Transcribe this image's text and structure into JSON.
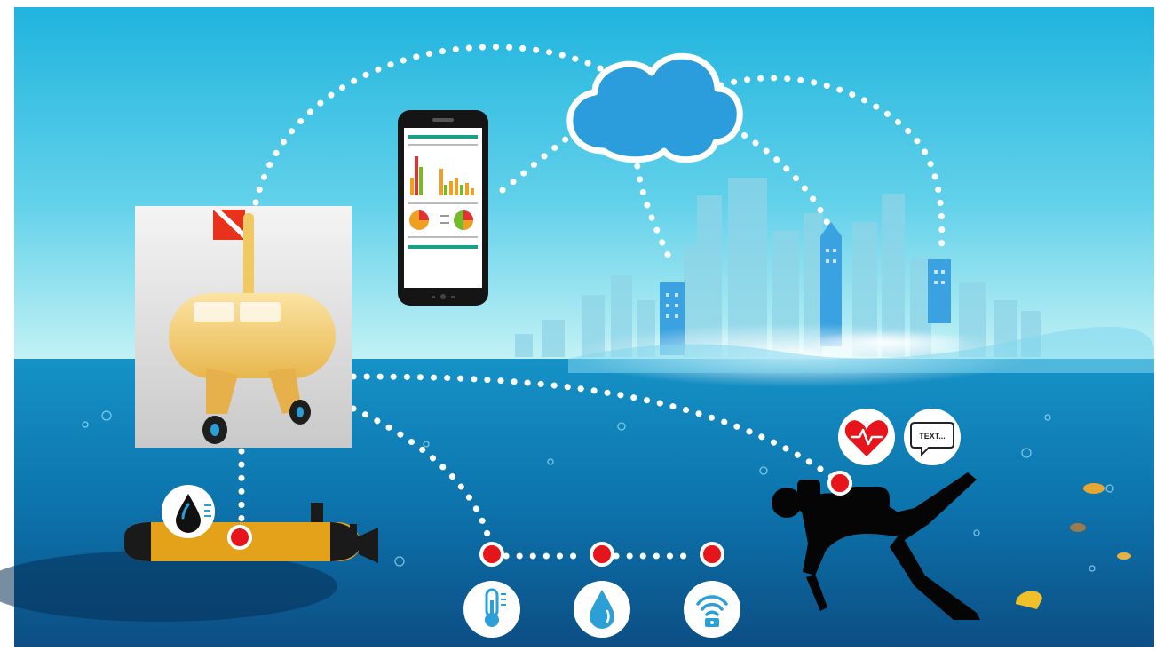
{
  "scene": {
    "colors": {
      "sky_top": "#21b6df",
      "sky_bottom": "#bff1f4",
      "sea_top": "#0e8ec4",
      "sea_bottom": "#0e4f86",
      "city": "#8bd2e6",
      "city_highlight": "#3aa2e0",
      "dots": "#ffffff",
      "node": "#e8141b",
      "vehicle_yellow": "#e3a21a",
      "buoy_yellow": "#f2cc72",
      "cloud": "#2b9ddc"
    }
  },
  "chat_bubble": {
    "text": "TEXT..."
  },
  "icons": [
    "cloud-icon",
    "smartphone-icon",
    "heart-rate-icon",
    "text-message-icon",
    "oil-drop-icon",
    "thermometer-icon",
    "water-drop-icon",
    "wireless-signal-icon"
  ]
}
